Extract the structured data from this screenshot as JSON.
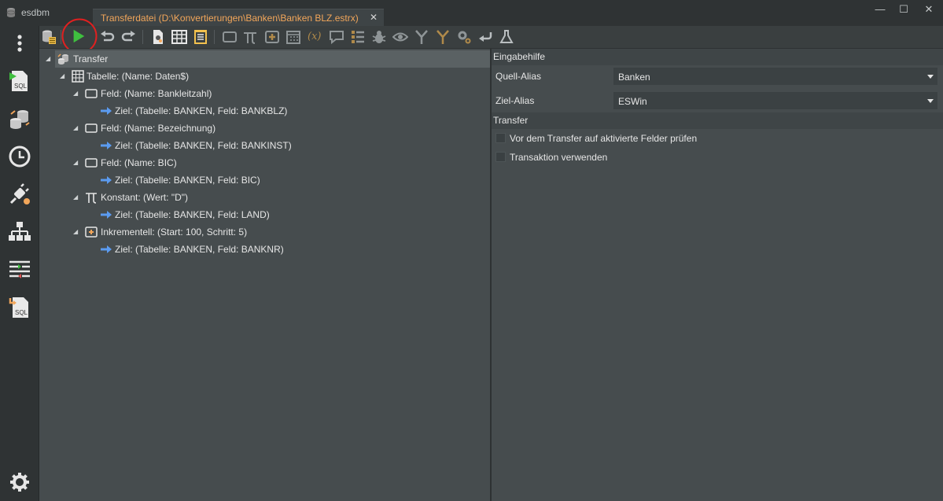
{
  "app": {
    "name": "esdbm"
  },
  "tab": {
    "title": "Transferdatei (D:\\Konvertierungen\\Banken\\Banken BLZ.estrx)",
    "close": "✕"
  },
  "window_controls": {
    "minimize": "—",
    "maximize": "☐",
    "close": "✕"
  },
  "colors": {
    "accent": "#f2a65a",
    "run": "#3fbf3f",
    "highlight_circle": "#e02020",
    "arrow": "#5b9bf0"
  },
  "sidebar": {
    "items": [
      {
        "icon": "more-vertical-icon"
      },
      {
        "icon": "sql-script-icon",
        "label": "SQL"
      },
      {
        "icon": "database-transfer-icon"
      },
      {
        "icon": "clock-icon"
      },
      {
        "icon": "plug-connection-icon"
      },
      {
        "icon": "hierarchy-icon"
      },
      {
        "icon": "compare-list-icon"
      },
      {
        "icon": "sql-import-icon",
        "label": "SQL"
      },
      {
        "icon": "settings-gear-icon"
      }
    ]
  },
  "toolbar": {
    "buttons": [
      "database-source-icon",
      "run-icon",
      "undo-icon",
      "redo-icon",
      "settings-doc-icon",
      "table-icon",
      "list-doc-icon",
      "field-icon",
      "pi-constant-icon",
      "increment-icon",
      "calendar-icon",
      "expression-icon",
      "comment-icon",
      "list-icon",
      "bug-icon",
      "eye-icon",
      "merge-icon",
      "split-icon",
      "gears-icon",
      "return-icon",
      "flask-icon"
    ],
    "expression_text": "(x)"
  },
  "tree": {
    "root": "Transfer",
    "nodes": [
      {
        "type": "table",
        "label": "Tabelle: (Name: Daten$)",
        "level": 1
      },
      {
        "type": "field",
        "label": "Feld: (Name: Bankleitzahl)",
        "level": 2
      },
      {
        "type": "target",
        "label": "Ziel: (Tabelle: BANKEN, Feld: BANKBLZ)",
        "level": 3
      },
      {
        "type": "field",
        "label": "Feld: (Name: Bezeichnung)",
        "level": 2
      },
      {
        "type": "target",
        "label": "Ziel: (Tabelle: BANKEN, Feld: BANKINST)",
        "level": 3
      },
      {
        "type": "field",
        "label": "Feld: (Name: BIC)",
        "level": 2
      },
      {
        "type": "target",
        "label": "Ziel: (Tabelle: BANKEN, Feld: BIC)",
        "level": 3
      },
      {
        "type": "constant",
        "label": "Konstant: (Wert: \"D\")",
        "level": 2
      },
      {
        "type": "target",
        "label": "Ziel: (Tabelle: BANKEN, Feld: LAND)",
        "level": 3
      },
      {
        "type": "increment",
        "label": "Inkrementell: (Start: 100, Schritt: 5)",
        "level": 2
      },
      {
        "type": "target",
        "label": "Ziel: (Tabelle: BANKEN, Feld: BANKNR)",
        "level": 3
      }
    ]
  },
  "properties": {
    "section1": "Eingabehilfe",
    "source_alias_label": "Quell-Alias",
    "source_alias_value": "Banken",
    "target_alias_label": "Ziel-Alias",
    "target_alias_value": "ESWin",
    "section2": "Transfer",
    "check1_label": "Vor dem Transfer auf aktivierte Felder prüfen",
    "check1_checked": false,
    "check2_label": "Transaktion verwenden",
    "check2_checked": false
  }
}
